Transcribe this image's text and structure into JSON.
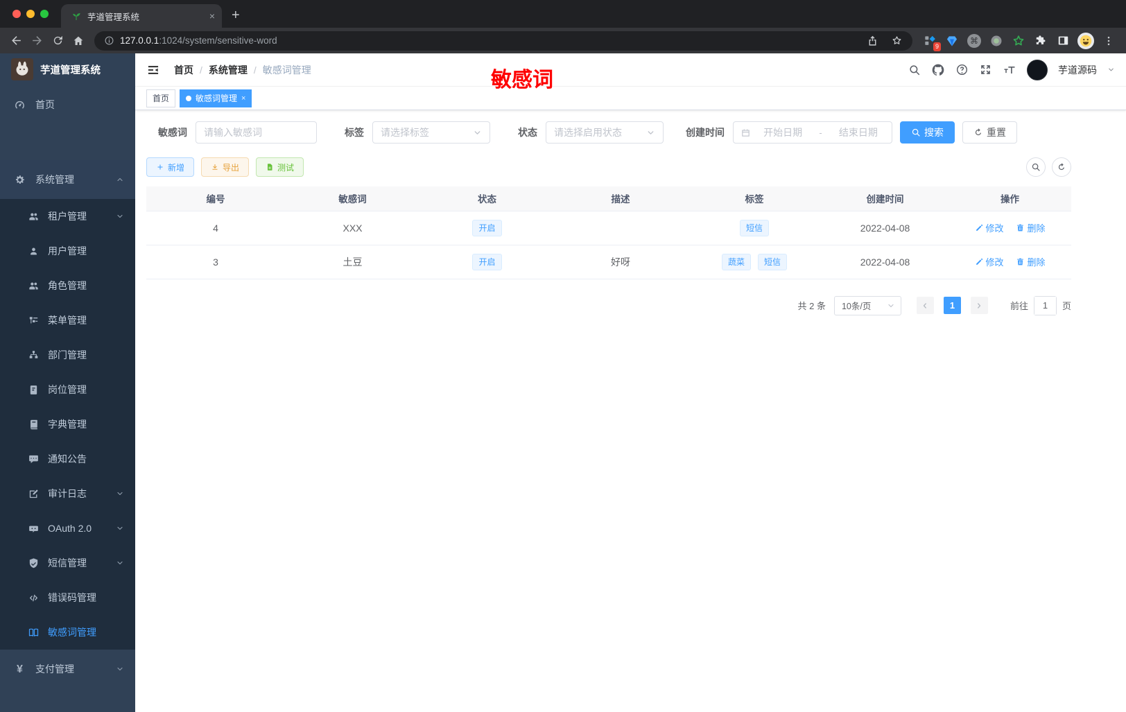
{
  "browser": {
    "tab_title": "芋道管理系统",
    "url_host": "127.0.0.1",
    "url_rest": ":1024/system/sensitive-word",
    "extension_badge": "9",
    "icons": [
      "back-icon",
      "forward-icon",
      "reload-icon",
      "home-icon",
      "info-icon",
      "share-icon",
      "star-icon",
      "command-icon",
      "puzzle-icon",
      "sidebar-panel-icon",
      "menu-dots-icon"
    ]
  },
  "sidebar": {
    "app_title": "芋道管理系统",
    "items": [
      {
        "label": "首页",
        "icon": "dashboard-icon"
      },
      {
        "label": "系统管理",
        "icon": "gear-icon",
        "expanded": true
      },
      {
        "label": "租户管理",
        "icon": "tenant-icon",
        "chevron": true
      },
      {
        "label": "用户管理",
        "icon": "user-icon"
      },
      {
        "label": "角色管理",
        "icon": "role-icon"
      },
      {
        "label": "菜单管理",
        "icon": "menu-tree-icon"
      },
      {
        "label": "部门管理",
        "icon": "dept-icon"
      },
      {
        "label": "岗位管理",
        "icon": "post-icon"
      },
      {
        "label": "字典管理",
        "icon": "dict-icon"
      },
      {
        "label": "通知公告",
        "icon": "notice-icon"
      },
      {
        "label": "审计日志",
        "icon": "audit-log-icon",
        "chevron": true
      },
      {
        "label": "OAuth 2.0",
        "icon": "oauth-icon",
        "chevron": true
      },
      {
        "label": "短信管理",
        "icon": "sms-icon",
        "chevron": true
      },
      {
        "label": "错误码管理",
        "icon": "error-code-icon"
      },
      {
        "label": "敏感词管理",
        "icon": "sensitive-word-icon",
        "active": true
      },
      {
        "label": "支付管理",
        "icon": "pay-icon",
        "chevron": true,
        "pay_glyph": "¥"
      }
    ]
  },
  "header": {
    "breadcrumb": [
      "首页",
      "系统管理",
      "敏感词管理"
    ],
    "separator": "/",
    "annotation": "敏感词",
    "username": "芋道源码",
    "icons": [
      "search-icon",
      "github-icon",
      "help-icon",
      "fullscreen-icon",
      "font-size-icon"
    ]
  },
  "tags_view": {
    "tabs": [
      {
        "label": "首页",
        "active": false
      },
      {
        "label": "敏感词管理",
        "active": true,
        "closable": "×"
      }
    ]
  },
  "filters": {
    "keyword": {
      "label": "敏感词",
      "placeholder": "请输入敏感词"
    },
    "tag": {
      "label": "标签",
      "placeholder": "请选择标签"
    },
    "status": {
      "label": "状态",
      "placeholder": "请选择启用状态"
    },
    "create_time": {
      "label": "创建时间",
      "start_placeholder": "开始日期",
      "separator": "-",
      "end_placeholder": "结束日期"
    },
    "search_label": "搜索",
    "reset_label": "重置"
  },
  "actions": {
    "add": "新增",
    "export": "导出",
    "test": "测试"
  },
  "table": {
    "columns": [
      "编号",
      "敏感词",
      "状态",
      "描述",
      "标签",
      "创建时间",
      "操作"
    ],
    "rows": [
      {
        "id": "4",
        "word": "XXX",
        "status": "开启",
        "description": "",
        "tags": [
          "短信"
        ],
        "create_time": "2022-04-08"
      },
      {
        "id": "3",
        "word": "土豆",
        "status": "开启",
        "description": "好呀",
        "tags": [
          "蔬菜",
          "短信"
        ],
        "create_time": "2022-04-08"
      }
    ],
    "row_actions": {
      "edit": "修改",
      "delete": "删除"
    }
  },
  "pagination": {
    "total": "共 2 条",
    "page_size": "10条/页",
    "current_page": "1",
    "goto_label": "前往",
    "goto_value": "1",
    "page_label": "页"
  },
  "colors": {
    "primary": "#409eff",
    "warning": "#e6a23c",
    "success": "#67c23a",
    "annotation_red": "#fe0000",
    "sidebar_bg": "#304156",
    "submenu_bg": "#1f2d3d"
  }
}
